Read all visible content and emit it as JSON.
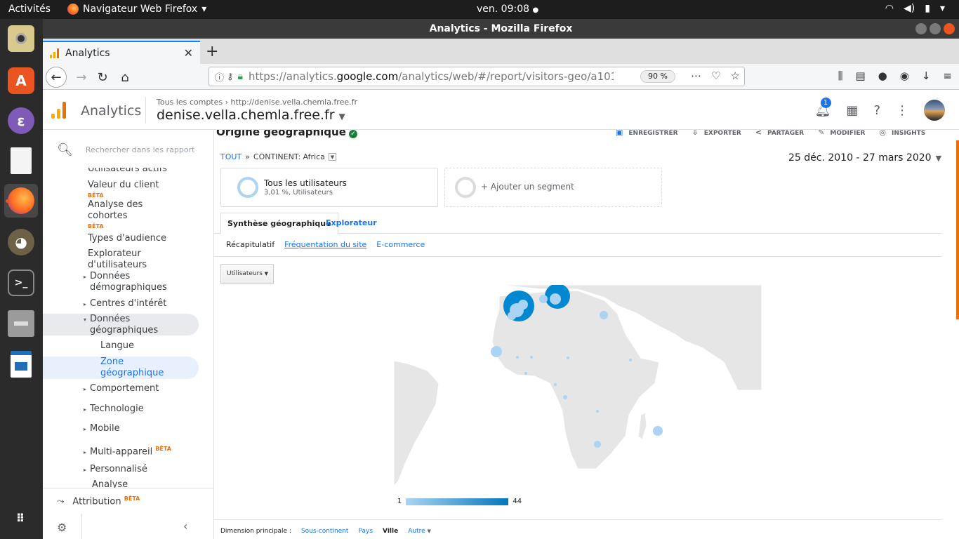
{
  "system_bar": {
    "activities": "Activités",
    "app_name": "Navigateur Web Firefox",
    "app_caret": "▾",
    "clock": "ven. 09:08"
  },
  "window": {
    "title": "Analytics - Mozilla Firefox"
  },
  "browser": {
    "tab_title": "Analytics",
    "url_prefix": "https://analytics.",
    "url_domain": "google.com",
    "url_rest": "/analytics/web/#/report/visitors-geo/a101613",
    "zoom": "90 %"
  },
  "ga_header": {
    "product": "Analytics",
    "breadcrumb_all": "Tous les comptes",
    "breadcrumb_sep": "›",
    "breadcrumb_account": "http://denise.vella.chemla.free.fr",
    "property": "denise.vella.chemla.free.fr",
    "notification_count": "1",
    "colors": {
      "logo_orange": "#f9ab00",
      "logo_dark": "#e37400",
      "accent": "#1a73e8"
    }
  },
  "sidebar": {
    "search_placeholder": "Rechercher dans les rapport",
    "items": {
      "partial_top": "Utilisateurs actifs",
      "valeur_client": "Valeur du client",
      "beta1": "BÊTA",
      "cohortes_l1": "Analyse des",
      "cohortes_l2": "cohortes",
      "beta2": "BÊTA",
      "types_audience": "Types d'audience",
      "explorateur_l1": "Explorateur",
      "explorateur_l2": "d'utilisateurs",
      "demographiques_l1": "Données",
      "demographiques_l2": "démographiques",
      "centres": "Centres d'intérêt",
      "geo_l1": "Données",
      "geo_l2": "géographiques",
      "langue": "Langue",
      "zone_l1": "Zone",
      "zone_l2": "géographique",
      "comportement": "Comportement",
      "technologie": "Technologie",
      "mobile": "Mobile",
      "multi_appareil": "Multi-appareil",
      "beta3": "BÊTA",
      "personnalise": "Personnalisé",
      "analyse_partial": "Analyse"
    },
    "attribution": "Attribution",
    "attribution_beta": "BÊTA"
  },
  "report": {
    "title": "Origine géographique",
    "actions": {
      "save": "ENREGISTRER",
      "export": "EXPORTER",
      "share": "PARTAGER",
      "edit": "MODIFIER",
      "insights": "INSIGHTS"
    },
    "filter": {
      "all": "TOUT",
      "sep": "»",
      "continent": "CONTINENT: Africa"
    },
    "date_range": "25 déc. 2010 - 27 mars 2020",
    "segments": {
      "all_users": "Tous les utilisateurs",
      "all_users_sub": "3,01 %, Utilisateurs",
      "add_segment": "+ Ajouter un segment"
    },
    "tabs": {
      "geo_summary": "Synthèse géographique",
      "explorer": "Explorateur"
    },
    "subtabs": {
      "summary": "Récapitulatif",
      "site_usage": "Fréquentation du site",
      "ecommerce": "E-commerce"
    },
    "metric_select": "Utilisateurs",
    "legend": {
      "min": "1",
      "max": "44"
    },
    "dimension": {
      "label": "Dimension principale :",
      "sub_continent": "Sous-continent",
      "country": "Pays",
      "city": "Ville",
      "other": "Autre"
    },
    "map_colors": {
      "land": "#e6e6e6",
      "border": "#ffffff",
      "bubble_light": "#aad4f2",
      "bubble_dark": "#0288d1"
    }
  }
}
